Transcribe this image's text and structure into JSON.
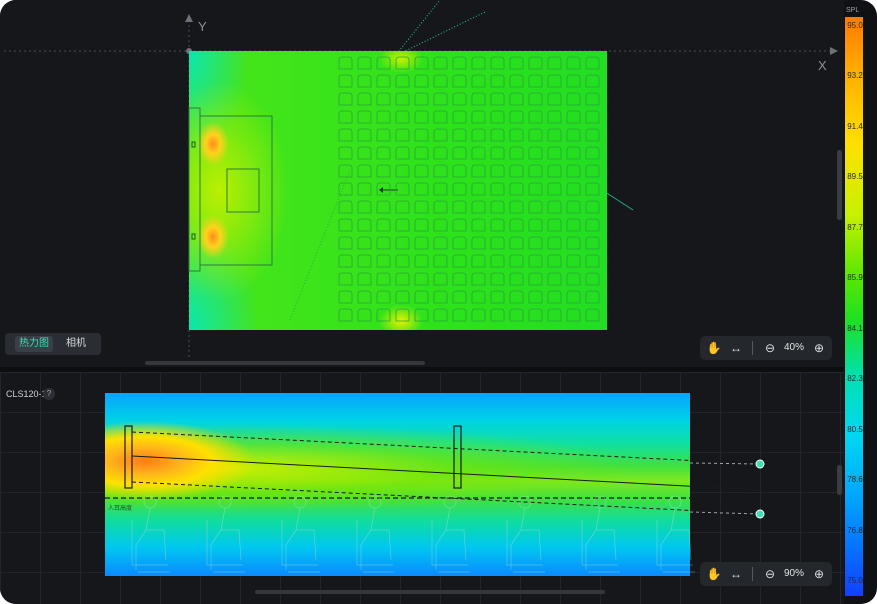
{
  "top_view": {
    "axis_y": "Y",
    "axis_x": "X",
    "tabs": [
      {
        "label": "热力图",
        "active": true
      },
      {
        "label": "相机",
        "active": false
      }
    ],
    "zoom": {
      "percent": "40%"
    }
  },
  "side_view": {
    "title": "CLS120-1",
    "help": "?",
    "listener_label": "人耳高度",
    "zoom": {
      "percent": "90%"
    }
  },
  "legend": {
    "title": "SPL",
    "ticks": [
      "95.0",
      "93.2",
      "91.4",
      "89.5",
      "87.7",
      "85.9",
      "84.1",
      "82.3",
      "80.5",
      "78.6",
      "76.8",
      "75.0"
    ]
  },
  "colors": {
    "accent": "#3ce0b4",
    "background": "#16171b"
  },
  "icons": {
    "pan": "hand-icon",
    "fit": "fit-width-icon",
    "zoom_out": "zoom-out-icon",
    "zoom_in": "zoom-in-icon"
  }
}
